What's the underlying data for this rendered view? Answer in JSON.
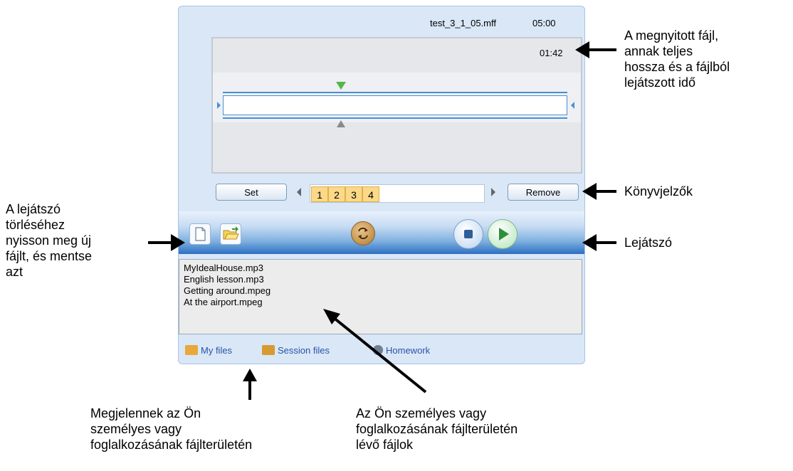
{
  "file": {
    "name": "test_3_1_05.mff",
    "length": "05:00",
    "played": "01:42"
  },
  "controls": {
    "set_label": "Set",
    "remove_label": "Remove",
    "bookmarks": [
      "1",
      "2",
      "3",
      "4"
    ]
  },
  "file_list": [
    "MyIdealHouse.mp3",
    "English lesson.mp3",
    "Getting around.mpeg",
    "At the airport.mpeg"
  ],
  "tabs": [
    "My files",
    "Session files",
    "Homework"
  ],
  "annotations": {
    "file_info": [
      "A megnyitott fájl,",
      "annak teljes",
      "hossza és a fájlból",
      "lejátszott idő"
    ],
    "bookmarks": "Könyvjelzők",
    "player": "Lejátszó",
    "clear_player": [
      "A lejátszó",
      "törléséhez",
      "nyisson meg új",
      "fájlt, és mentse",
      "azt"
    ],
    "appear_in_area": [
      "Megjelennek az Ön",
      "személyes vagy",
      "foglalkozásának fájlterületén"
    ],
    "files_in_area": [
      "Az Ön személyes vagy",
      "foglalkozásának fájlterületén",
      "lévő fájlok"
    ]
  },
  "colors": {
    "panel_bg": "#d9e7f7",
    "accent_blue": "#4a8fd0",
    "bookmark_fill": "#fbd988",
    "start_marker": "#52b848"
  },
  "icons": [
    "new-file-icon",
    "open-folder-icon",
    "loop-icon",
    "stop-icon",
    "play-icon",
    "my-files-icon",
    "session-files-icon",
    "homework-icon"
  ]
}
